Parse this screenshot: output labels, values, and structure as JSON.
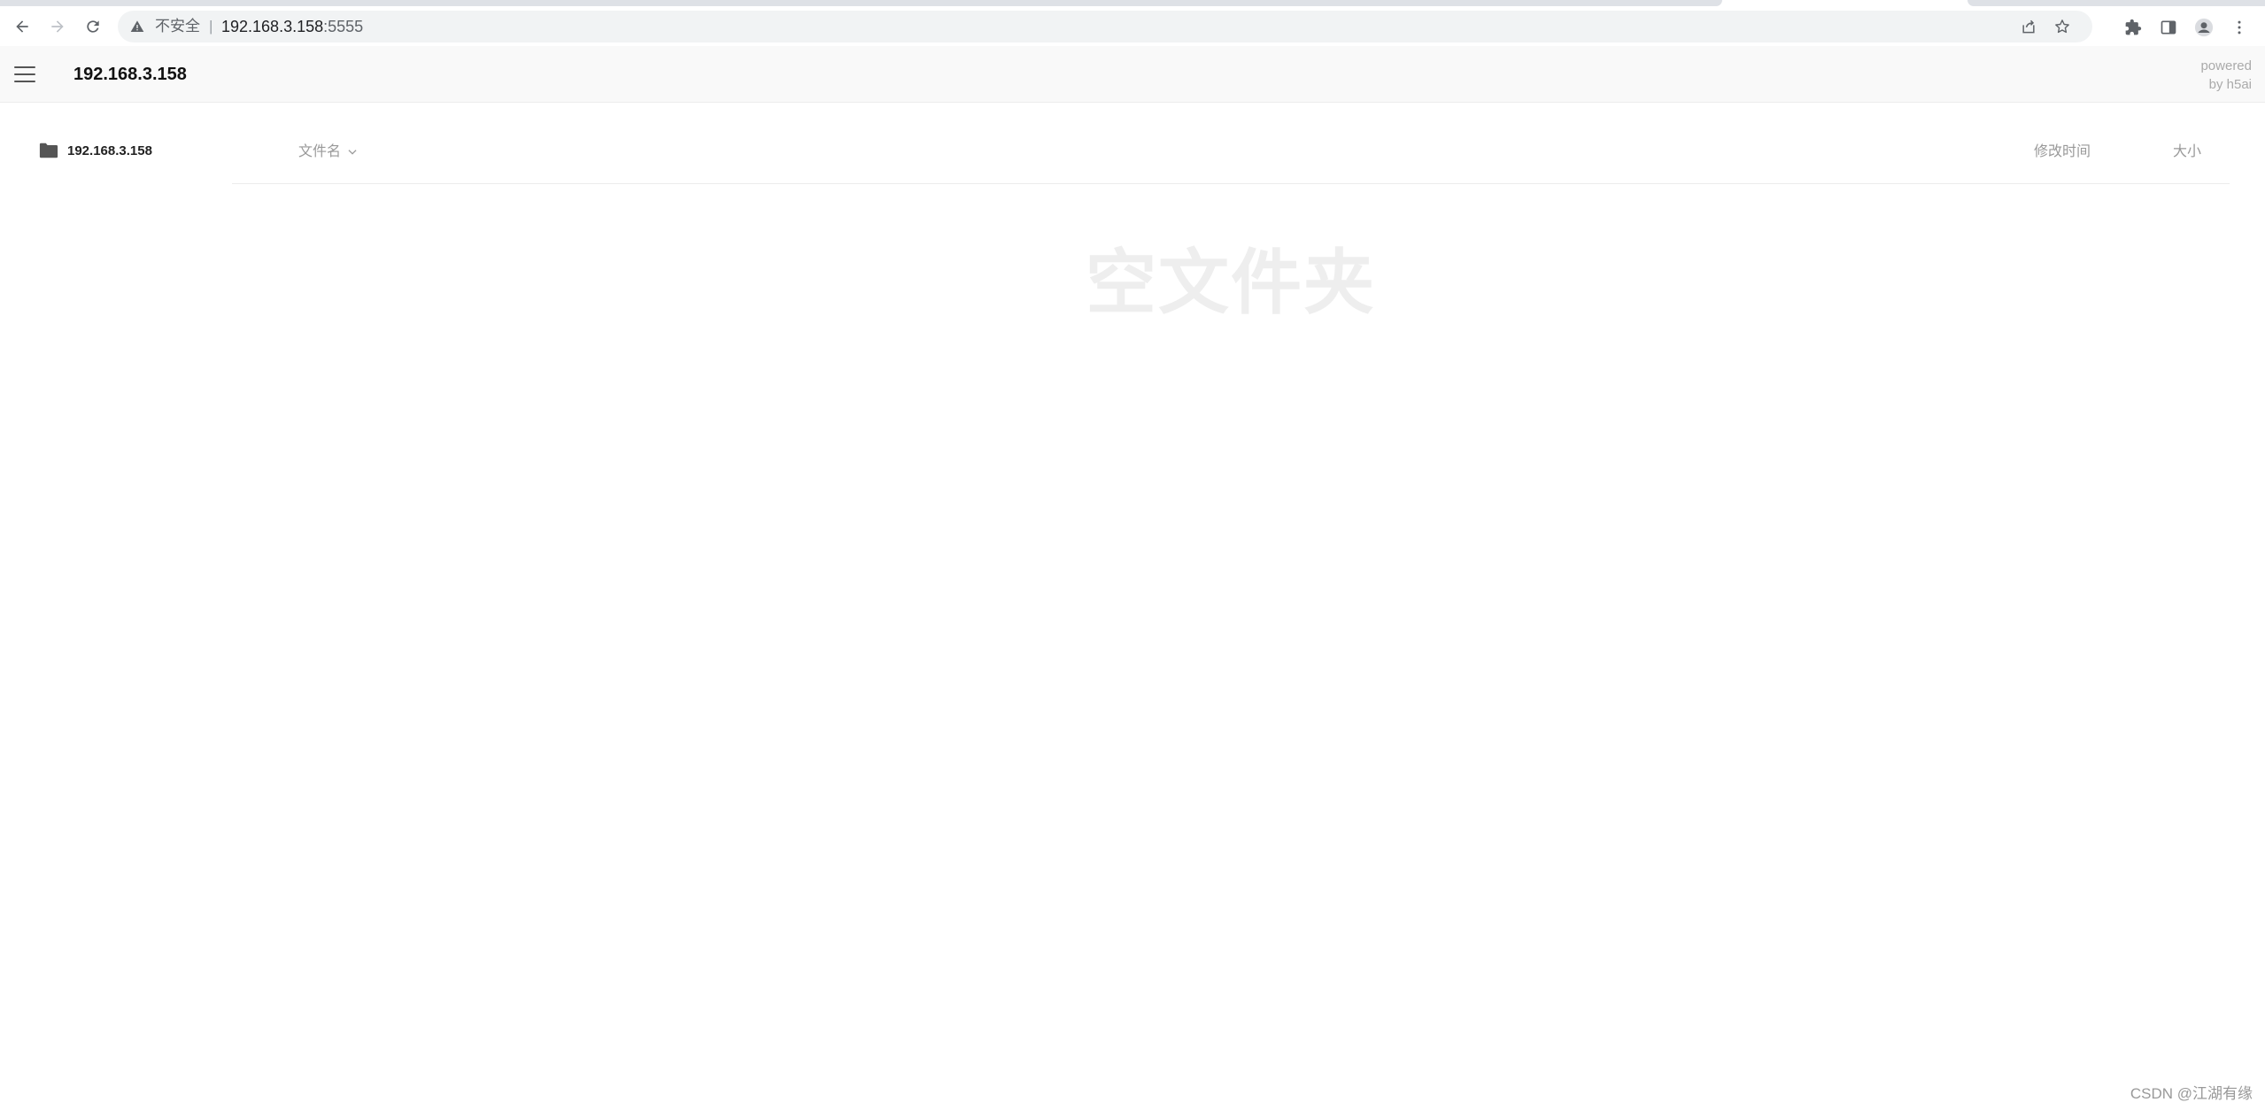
{
  "browser": {
    "security_label": "不安全",
    "separator": "|",
    "url_host": "192.168.3.158",
    "url_port": ":5555"
  },
  "topbar": {
    "crumb": "192.168.3.158",
    "powered_line1": "powered",
    "powered_line2": "by h5ai"
  },
  "sidebar": {
    "tree_root": "192.168.3.158"
  },
  "list": {
    "columns": {
      "name": "文件名",
      "date": "修改时间",
      "size": "大小"
    },
    "empty_message": "空文件夹"
  },
  "watermark": "CSDN @江湖有缘"
}
